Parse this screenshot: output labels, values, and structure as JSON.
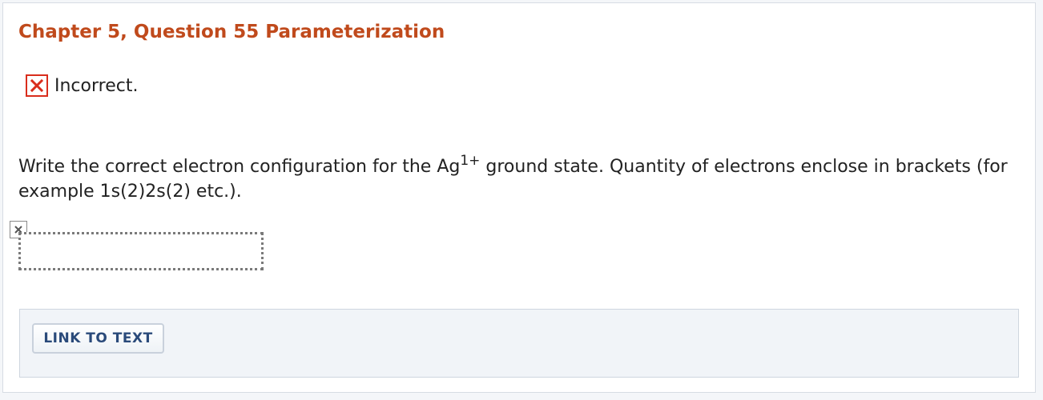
{
  "header": {
    "title": "Chapter 5, Question 55 Parameterization"
  },
  "feedback": {
    "icon": "x-mark-icon",
    "text": "Incorrect.",
    "color": "#d92d1c"
  },
  "question": {
    "text_before": "Write the correct electron configuration for the Ag",
    "superscript": "1+",
    "text_after": " ground state. Quantity of electrons enclose in brackets (for example 1s(2)2s(2) etc.)."
  },
  "answer": {
    "status_icon": "broken-image-icon",
    "value": "",
    "placeholder": ""
  },
  "footer": {
    "link_label": "LINK TO TEXT"
  },
  "colors": {
    "title": "#c04a1c",
    "incorrect": "#d92d1c",
    "link_text": "#2a4a7a"
  }
}
